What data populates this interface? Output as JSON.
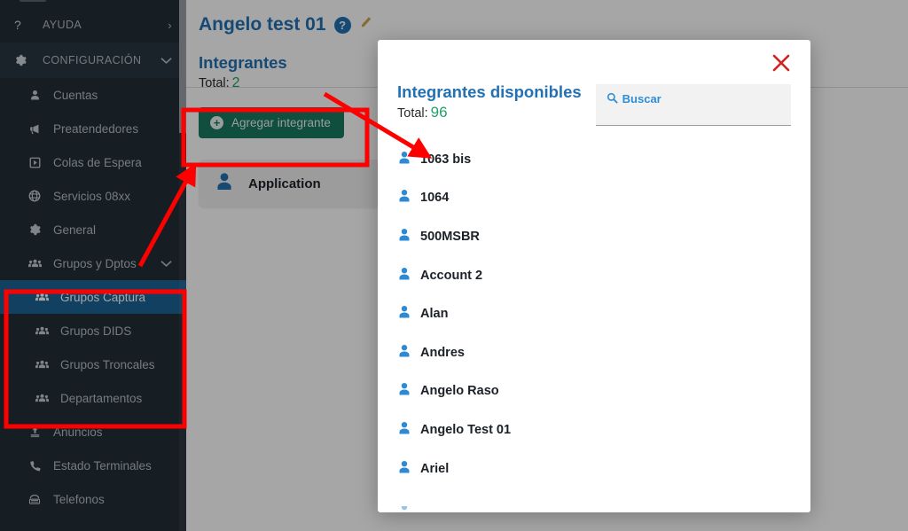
{
  "sidebar": {
    "sections": [
      {
        "id": "ayuda",
        "label": "AYUDA",
        "icon": "question-icon",
        "chevron": "›",
        "highlight": false
      },
      {
        "id": "configuracion",
        "label": "CONFIGURACIÓN",
        "icon": "gear-icon",
        "chevron": "⌄",
        "highlight": true
      }
    ],
    "items": [
      {
        "id": "cuentas",
        "label": "Cuentas",
        "icon": "user-icon",
        "active": false,
        "sub": false
      },
      {
        "id": "preatendedores",
        "label": "Preatendedores",
        "icon": "megaphone-icon",
        "active": false,
        "sub": false
      },
      {
        "id": "colas-de-espera",
        "label": "Colas de Espera",
        "icon": "play-box-icon",
        "active": false,
        "sub": false
      },
      {
        "id": "servicios-08xx",
        "label": "Servicios 08xx",
        "icon": "globe-icon",
        "active": false,
        "sub": false
      },
      {
        "id": "general",
        "label": "General",
        "icon": "gear-icon",
        "active": false,
        "sub": false
      },
      {
        "id": "grupos-y-dptos",
        "label": "Grupos y Dptos",
        "icon": "group-icon",
        "active": false,
        "sub": false,
        "chevron": "⌄"
      },
      {
        "id": "grupos-captura",
        "label": "Grupos Captura",
        "icon": "group-icon",
        "active": true,
        "sub": true
      },
      {
        "id": "grupos-dids",
        "label": "Grupos DIDS",
        "icon": "group-icon",
        "active": false,
        "sub": true
      },
      {
        "id": "grupos-troncales",
        "label": "Grupos Troncales",
        "icon": "group-icon",
        "active": false,
        "sub": true
      },
      {
        "id": "departamentos",
        "label": "Departamentos",
        "icon": "group-icon",
        "active": false,
        "sub": true
      },
      {
        "id": "anuncios",
        "label": "Anuncios",
        "icon": "upload-icon",
        "active": false,
        "sub": false
      },
      {
        "id": "estado-terminales",
        "label": "Estado Terminales",
        "icon": "phone-icon",
        "active": false,
        "sub": false
      },
      {
        "id": "telefonos",
        "label": "Telefonos",
        "icon": "desk-phone-icon",
        "active": false,
        "sub": false
      }
    ]
  },
  "page": {
    "title": "Angelo test 01",
    "help_icon_label": "?",
    "edit_icon_label": "✎",
    "section_title": "Integrantes",
    "total_label": "Total:",
    "total_value": "2",
    "add_button_label": "Agregar integrante",
    "members": [
      {
        "name": "Application"
      }
    ]
  },
  "modal": {
    "title": "Integrantes disponibles",
    "total_label": "Total:",
    "total_value": "96",
    "close_label": "×",
    "search_placeholder": "Buscar",
    "search_value": "",
    "items": [
      {
        "name": "1063 bis"
      },
      {
        "name": "1064"
      },
      {
        "name": "500MSBR"
      },
      {
        "name": "Account 2"
      },
      {
        "name": "Alan"
      },
      {
        "name": "Andres"
      },
      {
        "name": "Angelo Raso"
      },
      {
        "name": "Angelo Test 01"
      },
      {
        "name": "Ariel"
      }
    ]
  },
  "colors": {
    "sidebar_bg": "#222d36",
    "sidebar_active": "#1c6394",
    "accent_blue": "#2271b3",
    "green_total": "#23a06b",
    "button_green": "#19795e",
    "annotation_red": "#ff0000",
    "close_red": "#d32020"
  }
}
